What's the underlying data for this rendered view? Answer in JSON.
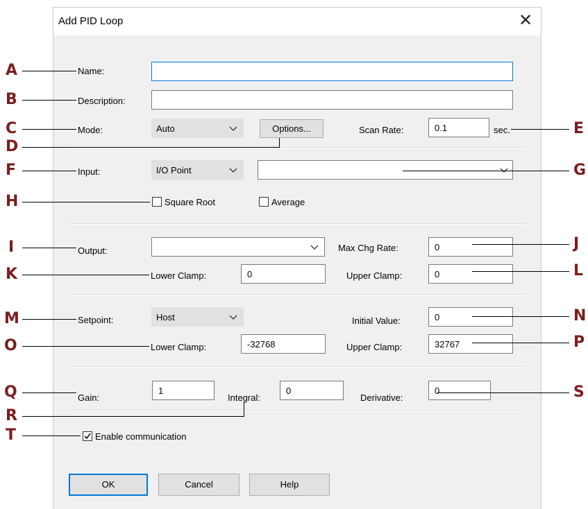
{
  "dialog": {
    "title": "Add PID Loop",
    "close_glyph": "✕"
  },
  "fields": {
    "name_label": "Name:",
    "name_value": "",
    "description_label": "Description:",
    "description_value": "",
    "mode_label": "Mode:",
    "mode_value": "Auto",
    "options_button": "Options...",
    "scan_rate_label": "Scan Rate:",
    "scan_rate_value": "0.1",
    "scan_rate_unit": "sec.",
    "input_label": "Input:",
    "input_type_value": "I/O Point",
    "input_point_value": "",
    "square_root_label": "Square Root",
    "average_label": "Average",
    "output_label": "Output:",
    "output_value": "",
    "max_chg_rate_label": "Max Chg Rate:",
    "max_chg_rate_value": "0",
    "output_lower_clamp_label": "Lower Clamp:",
    "output_lower_clamp_value": "0",
    "output_upper_clamp_label": "Upper Clamp:",
    "output_upper_clamp_value": "0",
    "setpoint_label": "Setpoint:",
    "setpoint_value": "Host",
    "initial_value_label": "Initial Value:",
    "initial_value_value": "0",
    "setpoint_lower_clamp_label": "Lower Clamp:",
    "setpoint_lower_clamp_value": "-32768",
    "setpoint_upper_clamp_label": "Upper Clamp:",
    "setpoint_upper_clamp_value": "32767",
    "gain_label": "Gain:",
    "gain_value": "1",
    "integral_label": "Integral:",
    "integral_value": "0",
    "derivative_label": "Derivative:",
    "derivative_value": "0",
    "enable_comm_label": "Enable communication",
    "enable_comm_checked": true,
    "square_root_checked": false,
    "average_checked": false
  },
  "buttons": {
    "ok": "OK",
    "cancel": "Cancel",
    "help": "Help"
  },
  "callouts": [
    "A",
    "B",
    "C",
    "D",
    "E",
    "F",
    "G",
    "H",
    "I",
    "J",
    "K",
    "L",
    "M",
    "N",
    "O",
    "P",
    "Q",
    "R",
    "S",
    "T"
  ],
  "colors": {
    "callout_text": "#7a1e1e",
    "focus_border": "#0078d7",
    "dialog_bg": "#f0f0f0"
  }
}
